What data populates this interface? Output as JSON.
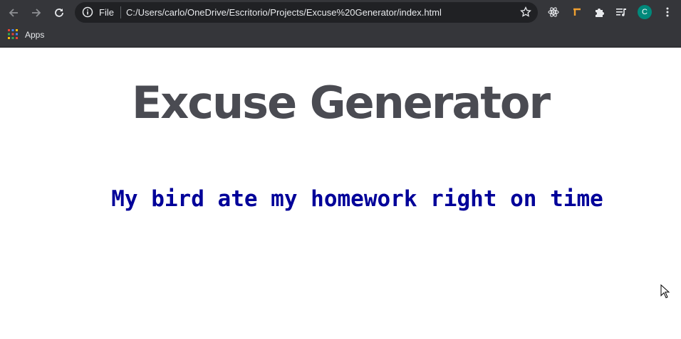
{
  "browser": {
    "omnibox": {
      "scheme_label": "File",
      "url": "C:/Users/carlo/OneDrive/Escritorio/Projects/Excuse%20Generator/index.html"
    },
    "profile_initial": "C",
    "bookmarks": {
      "apps_label": "Apps"
    },
    "icons": [
      "back-icon",
      "forward-icon",
      "reload-icon",
      "info-icon",
      "star-icon",
      "react-devtools-icon",
      "extension-icon-orange",
      "puzzle-icon",
      "media-icon",
      "avatar",
      "kebab-menu-icon"
    ]
  },
  "page": {
    "title": "Excuse Generator",
    "excuse": "My bird ate my homework right on time"
  },
  "colors": {
    "title": "#4a4b52",
    "excuse": "#000099",
    "toolbar": "#35363a",
    "omnibox": "#202124",
    "avatar": "#00897b"
  }
}
